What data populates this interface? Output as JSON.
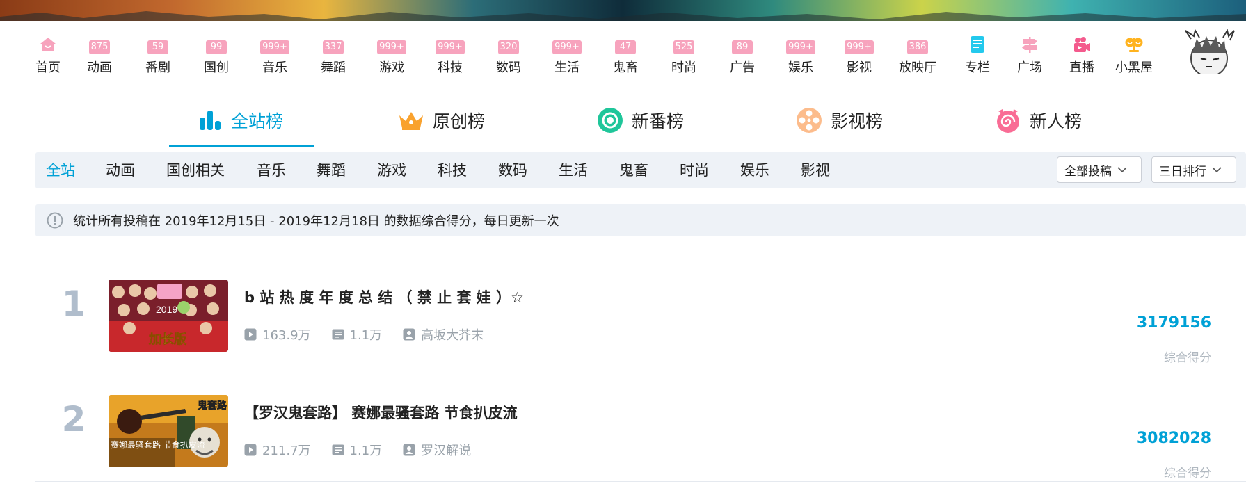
{
  "nav": {
    "items": [
      {
        "label": "首页",
        "badge": null,
        "icon": "home-icon"
      },
      {
        "label": "动画",
        "badge": "875"
      },
      {
        "label": "番剧",
        "badge": "59"
      },
      {
        "label": "国创",
        "badge": "99"
      },
      {
        "label": "音乐",
        "badge": "999+"
      },
      {
        "label": "舞蹈",
        "badge": "337"
      },
      {
        "label": "游戏",
        "badge": "999+"
      },
      {
        "label": "科技",
        "badge": "999+"
      },
      {
        "label": "数码",
        "badge": "320"
      },
      {
        "label": "生活",
        "badge": "999+"
      },
      {
        "label": "鬼畜",
        "badge": "47"
      },
      {
        "label": "时尚",
        "badge": "525"
      },
      {
        "label": "广告",
        "badge": "89"
      },
      {
        "label": "娱乐",
        "badge": "999+"
      },
      {
        "label": "影视",
        "badge": "999+"
      },
      {
        "label": "放映厅",
        "badge": "386"
      },
      {
        "label": "专栏",
        "badge": null,
        "icon": "column-icon"
      },
      {
        "label": "广场",
        "badge": null,
        "icon": "signpost-icon"
      },
      {
        "label": "直播",
        "badge": null,
        "icon": "camera-icon"
      },
      {
        "label": "小黑屋",
        "badge": null,
        "icon": "scales-icon"
      }
    ]
  },
  "rank_tabs": [
    {
      "label": "全站榜",
      "icon": "bar-chart-icon",
      "active": true
    },
    {
      "label": "原创榜",
      "icon": "crown-icon"
    },
    {
      "label": "新番榜",
      "icon": "circle-target-icon"
    },
    {
      "label": "影视榜",
      "icon": "film-reel-icon"
    },
    {
      "label": "新人榜",
      "icon": "spiral-icon"
    }
  ],
  "categories": [
    "全站",
    "动画",
    "国创相关",
    "音乐",
    "舞蹈",
    "游戏",
    "科技",
    "数码",
    "生活",
    "鬼畜",
    "时尚",
    "娱乐",
    "影视"
  ],
  "filters": {
    "submission": "全部投稿",
    "period": "三日排行"
  },
  "notice": "统计所有投稿在 2019年12月15日 - 2019年12月18日 的数据综合得分，每日更新一次",
  "ranking": [
    {
      "rank": "1",
      "title": "b 站 热 度 年 度 总 结 （ 禁 止 套 娃 ）☆",
      "views": "163.9万",
      "comments": "1.1万",
      "author": "高坂大芥末",
      "score": "3179156",
      "score_label": "综合得分",
      "thumb_text": "2019",
      "thumb_caption": "加长版"
    },
    {
      "rank": "2",
      "title": "【罗汉鬼套路】 赛娜最骚套路 节食扒皮流",
      "views": "211.7万",
      "comments": "1.1万",
      "author": "罗汉解说",
      "score": "3082028",
      "score_label": "综合得分",
      "thumb_text": "鬼套路",
      "thumb_caption": "赛娜最骚套路 节食扒皮流"
    }
  ],
  "colors": {
    "accent": "#00a1d6",
    "badge": "#f7a3bd",
    "rank_number": "#b0bdcc",
    "muted": "#99a2aa"
  }
}
